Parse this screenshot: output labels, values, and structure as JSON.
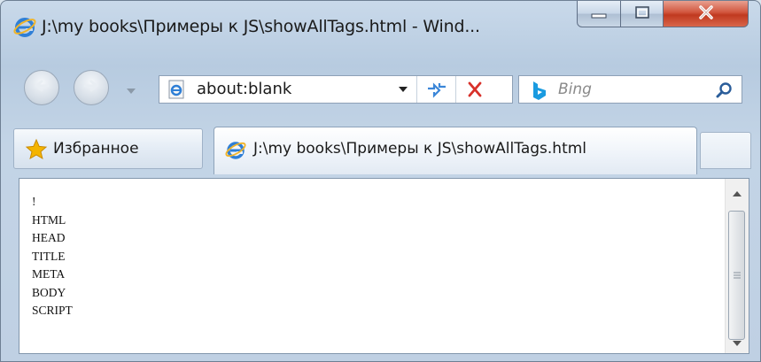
{
  "window": {
    "title": "J:\\my books\\Примеры к JS\\showAllTags.html - Wind..."
  },
  "caption_buttons": {
    "minimize_icon": "minimize-icon",
    "maximize_icon": "maximize-icon",
    "close_icon": "close-icon",
    "close_color": "#c7402a"
  },
  "navigation": {
    "back_icon": "back-arrow-icon",
    "forward_icon": "forward-arrow-icon",
    "address": {
      "value": "about:blank",
      "page_icon": "ie-page-icon"
    },
    "search": {
      "placeholder": "Bing",
      "provider_icon": "bing-logo-icon",
      "button_icon": "magnifier-icon"
    }
  },
  "tabs": {
    "favorites_label": "Избранное",
    "active_tab_label": "J:\\my books\\Примеры к JS\\showAllTags.html"
  },
  "content": {
    "lines": [
      "!",
      "HTML",
      "HEAD",
      "TITLE",
      "META",
      "BODY",
      "SCRIPT"
    ]
  },
  "colors": {
    "ie_blue": "#2f7fd6",
    "stop_red": "#d8312a",
    "favorites_star": "#f4b400",
    "bing_blue": "#1a9be0"
  }
}
